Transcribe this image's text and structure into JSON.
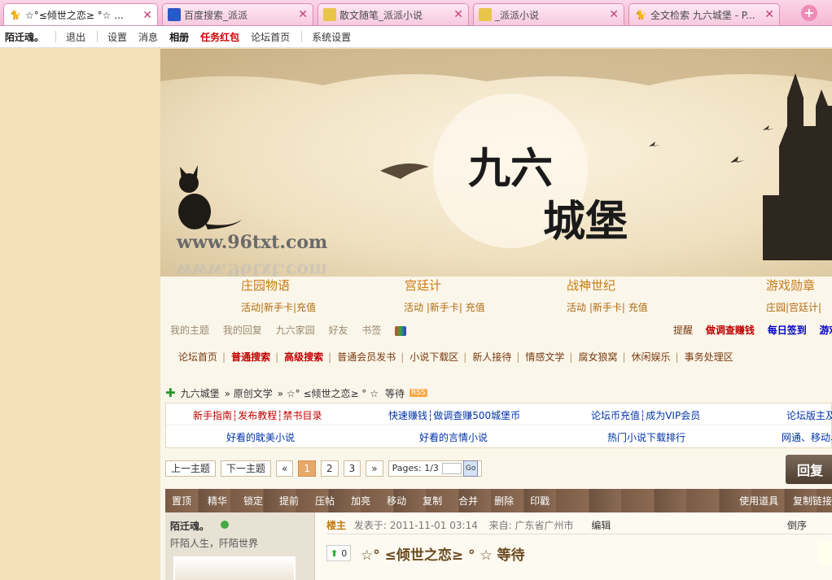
{
  "tabs": [
    {
      "label": "☆°≤倾世之恋≥ °☆ ...",
      "icon": "cat-icon",
      "active": true
    },
    {
      "label": "百度搜索_派派",
      "icon": "paw-icon"
    },
    {
      "label": "散文随笔_派派小说",
      "icon": "book-icon"
    },
    {
      "label": "_派派小说",
      "icon": "book-icon"
    },
    {
      "label": "全文检索 九六城堡 - P...",
      "icon": "cat-icon"
    }
  ],
  "topnav": {
    "user": "陌迁魂。",
    "logout": "退出",
    "settings": "设置",
    "messages": "消息",
    "album": "相册",
    "task_redpack": "任务红包",
    "forum_home": "论坛首页",
    "system_settings": "系统设置"
  },
  "banner": {
    "title": "九六城堡",
    "url_text": "www.96txt.com"
  },
  "games": [
    {
      "name": "庄园物语",
      "links": "活动|新手卡|充值"
    },
    {
      "name": "宫廷计",
      "links": "活动 |新手卡| 充值"
    },
    {
      "name": "战神世纪",
      "links": "活动 |新手卡| 充值"
    },
    {
      "name": "游戏勋章",
      "links": "庄园|宫廷计|"
    }
  ],
  "userlinks": [
    "我的主题",
    "我的回复",
    "九六家园",
    "好友",
    "书签"
  ],
  "rightlinks": [
    {
      "label": "提醒",
      "color": "#7a3a10"
    },
    {
      "label": "做调查赚钱",
      "color": "#c00000"
    },
    {
      "label": "每日签到",
      "color": "#0000cc"
    },
    {
      "label": "游戏",
      "color": "#0000cc"
    }
  ],
  "forumnav": [
    {
      "label": "论坛首页",
      "color": "#7a3a10"
    },
    {
      "label": "普通搜索",
      "color": "#c00000"
    },
    {
      "label": "高级搜索",
      "color": "#c00000"
    },
    {
      "label": "普通会员发书",
      "color": "#7a3a10"
    },
    {
      "label": "小说下载区",
      "color": "#7a3a10"
    },
    {
      "label": "新人接待",
      "color": "#7a3a10"
    },
    {
      "label": "情感文学",
      "color": "#7a3a10"
    },
    {
      "label": "腐女狼窝",
      "color": "#7a3a10"
    },
    {
      "label": "休闲娱乐",
      "color": "#7a3a10"
    },
    {
      "label": "事务处理区",
      "color": "#7a3a10"
    }
  ],
  "breadcrumb": {
    "home": "九六城堡",
    "section": "» 原创文学",
    "thread": "» ☆° ≤倾世之恋≥ ° ☆",
    "waiting": "等待",
    "rss": "RSS"
  },
  "notice": {
    "row1": [
      {
        "text": "新手指南┆发布教程┆禁书目录",
        "color": "#c00000"
      },
      {
        "text": "快速赚钱┆做调查赚500城堡币",
        "color": "#0033aa"
      },
      {
        "text": "论坛币充值┆成为VIP会员",
        "color": "#0033aa"
      },
      {
        "text": "论坛版主及",
        "color": "#0033aa"
      }
    ],
    "row2": [
      {
        "text": "好看的耽美小说",
        "color": "#0033aa"
      },
      {
        "text": "好看的言情小说",
        "color": "#0033aa"
      },
      {
        "text": "热门小说下载排行",
        "color": "#0033aa"
      },
      {
        "text": "网通、移动、",
        "color": "#0033aa"
      }
    ]
  },
  "pager": {
    "prev_topic": "上一主题",
    "next_topic": "下一主题",
    "first": "«",
    "pages": [
      "1",
      "2",
      "3"
    ],
    "next": "»",
    "pages_label": "Pages: 1/3",
    "go": "Go",
    "current_page": 1
  },
  "reply_button": "回复",
  "modbar": [
    "置顶",
    "精华",
    "锁定",
    "提前",
    "压帖",
    "加亮",
    "移动",
    "复制",
    "合并",
    "删除",
    "印戳"
  ],
  "modbar_right": [
    "使用道具",
    "复制链接"
  ],
  "post": {
    "author": "陌迁魂。",
    "signature": "阡陌人生，阡陌世界",
    "louzhu": "楼主",
    "posted": "发表于: 2011-11-01 03:14",
    "from": "来自: 广东省广州市",
    "edit": "编辑",
    "sort": "倒序",
    "likes": "0",
    "title": "☆° ≤倾世之恋≥ ° ☆   等待"
  }
}
